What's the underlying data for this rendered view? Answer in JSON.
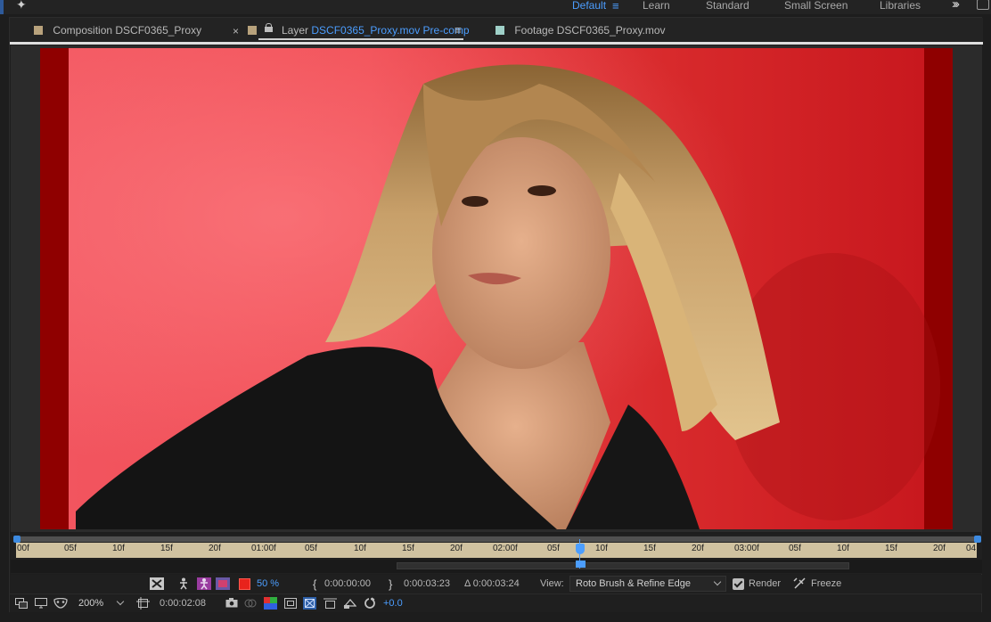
{
  "workspace": {
    "items": [
      {
        "label": "Default",
        "active": true
      },
      {
        "label": "Learn",
        "active": false
      },
      {
        "label": "Standard",
        "active": false
      },
      {
        "label": "Small Screen",
        "active": false
      },
      {
        "label": "Libraries",
        "active": false
      }
    ]
  },
  "tabs": {
    "composition": {
      "prefix": "Composition",
      "name": "DSCF0365_Proxy",
      "swatch": "#b8a27c"
    },
    "layer": {
      "prefix": "Layer",
      "name": "DSCF0365_Proxy.mov Pre-comp",
      "swatch": "#b8a27c"
    },
    "footage": {
      "prefix": "Footage",
      "name": "DSCF0365_Proxy.mov",
      "swatch": "#9fd0c8"
    },
    "close_glyph": "×",
    "menu_glyph": "≡"
  },
  "ruler": {
    "ticks": [
      "00f",
      "05f",
      "10f",
      "15f",
      "20f",
      "01:00f",
      "05f",
      "10f",
      "15f",
      "20f",
      "02:00f",
      "05f",
      "10f",
      "15f",
      "20f",
      "03:00f",
      "05f",
      "10f",
      "15f",
      "20f",
      "04"
    ]
  },
  "toolbar1": {
    "opacity": "50 %",
    "in_point": "0:00:00:00",
    "out_point": "0:00:03:23",
    "duration": "Δ 0:00:03:24",
    "view_label": "View:",
    "view_value": "Roto Brush & Refine Edge",
    "render_label": "Render",
    "freeze_label": "Freeze",
    "overlay_color": "#e8231c"
  },
  "toolbar2": {
    "zoom": "200%",
    "timecode": "0:00:02:08",
    "exposure": "+0.0"
  },
  "colors": {
    "accent": "#4c9eff",
    "ruler": "#d0c2a0"
  }
}
